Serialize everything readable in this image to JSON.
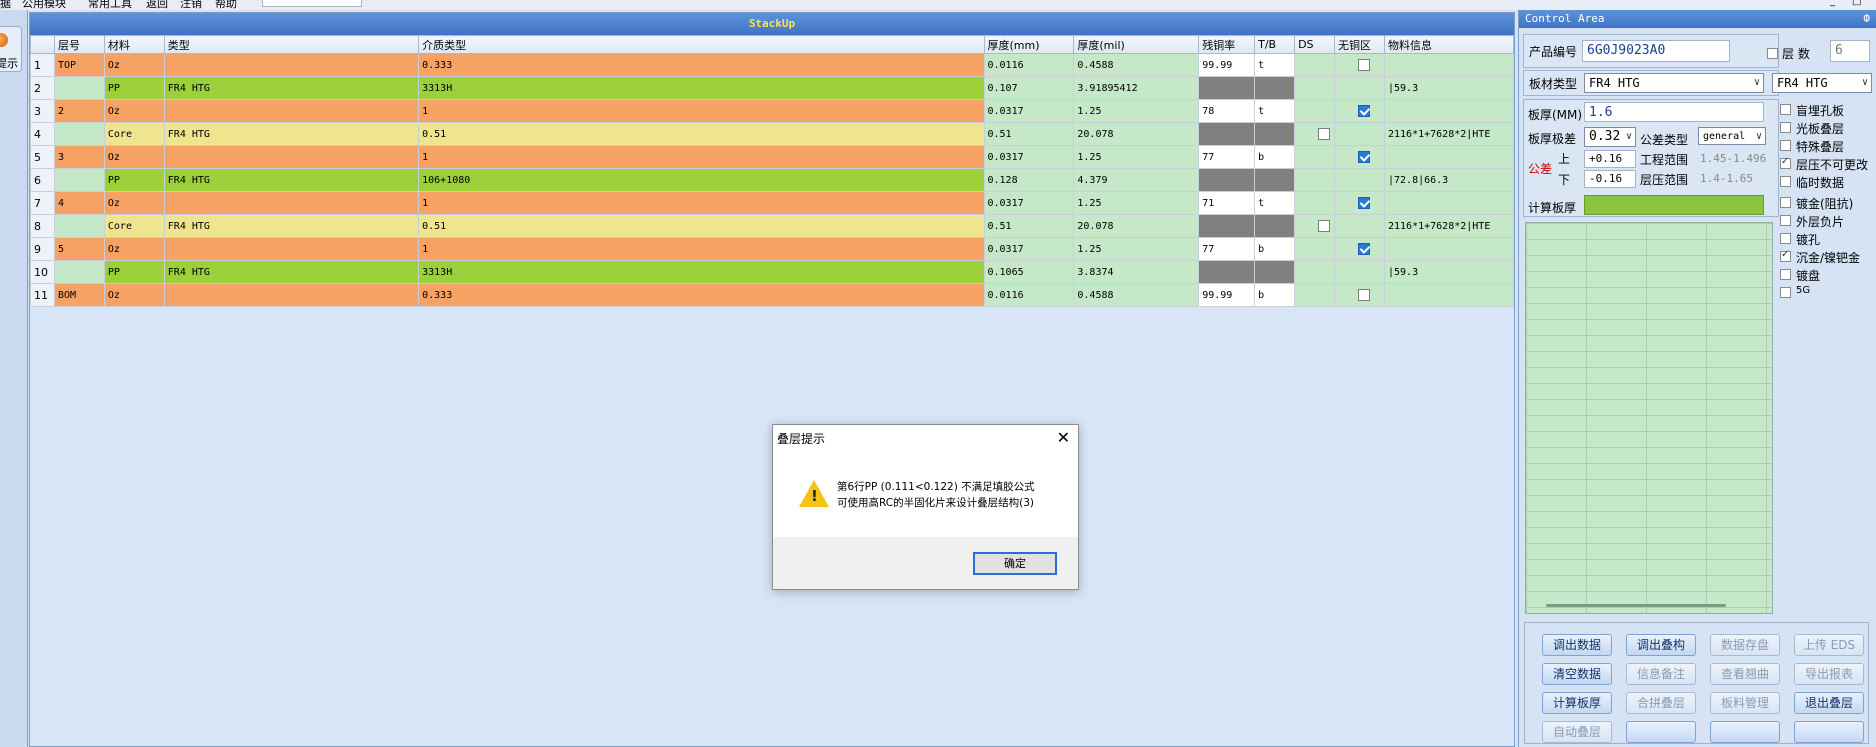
{
  "menubar": {
    "items": [
      "据",
      "公用模块",
      "常用工具",
      "返回",
      "注销",
      "帮助"
    ],
    "controls": [
      "_",
      "□"
    ]
  },
  "left": {
    "tip_label": "提示"
  },
  "stackup": {
    "title": "StackUp",
    "headers": [
      "",
      "层号",
      "材料",
      "类型",
      "介质类型",
      "厚度(mm)",
      "厚度(mil)",
      "残铜率",
      "T/B",
      "DS",
      "无铜区",
      "物料信息"
    ],
    "rows": [
      {
        "n": "1",
        "layer": "TOP",
        "material": "Oz",
        "type": "",
        "dielectric": "0.333",
        "mm": "0.0116",
        "mil": "0.4588",
        "rc": "99.99",
        "tb": "t",
        "ds": "",
        "nocu": "off",
        "info": "",
        "kind": "oz"
      },
      {
        "n": "2",
        "layer": "",
        "material": "PP",
        "type": "FR4 HTG",
        "dielectric": "3313H",
        "mm": "0.107",
        "mil": "3.91895412",
        "rc": "",
        "tb": "",
        "ds": "",
        "nocu": "",
        "info": "|59.3",
        "kind": "pp"
      },
      {
        "n": "3",
        "layer": "2",
        "material": "Oz",
        "type": "",
        "dielectric": "1",
        "mm": "0.0317",
        "mil": "1.25",
        "rc": "78",
        "tb": "t",
        "ds": "",
        "nocu": "on",
        "info": "",
        "kind": "oz"
      },
      {
        "n": "4",
        "layer": "",
        "material": "Core",
        "type": "FR4 HTG",
        "dielectric": "0.51",
        "mm": "0.51",
        "mil": "20.078",
        "rc": "",
        "tb": "",
        "ds": "off",
        "nocu": "",
        "info": "2116*1+7628*2|HTE",
        "kind": "core"
      },
      {
        "n": "5",
        "layer": "3",
        "material": "Oz",
        "type": "",
        "dielectric": "1",
        "mm": "0.0317",
        "mil": "1.25",
        "rc": "77",
        "tb": "b",
        "ds": "",
        "nocu": "on",
        "info": "",
        "kind": "oz"
      },
      {
        "n": "6",
        "layer": "",
        "material": "PP",
        "type": "FR4 HTG",
        "dielectric": "106+1080",
        "mm": "0.128",
        "mil": "4.379",
        "rc": "",
        "tb": "",
        "ds": "",
        "nocu": "",
        "info": "|72.8|66.3",
        "kind": "pp"
      },
      {
        "n": "7",
        "layer": "4",
        "material": "Oz",
        "type": "",
        "dielectric": "1",
        "mm": "0.0317",
        "mil": "1.25",
        "rc": "71",
        "tb": "t",
        "ds": "",
        "nocu": "on",
        "info": "",
        "kind": "oz"
      },
      {
        "n": "8",
        "layer": "",
        "material": "Core",
        "type": "FR4 HTG",
        "dielectric": "0.51",
        "mm": "0.51",
        "mil": "20.078",
        "rc": "",
        "tb": "",
        "ds": "off",
        "nocu": "",
        "info": "2116*1+7628*2|HTE",
        "kind": "core"
      },
      {
        "n": "9",
        "layer": "5",
        "material": "Oz",
        "type": "",
        "dielectric": "1",
        "mm": "0.0317",
        "mil": "1.25",
        "rc": "77",
        "tb": "b",
        "ds": "",
        "nocu": "on",
        "info": "",
        "kind": "oz"
      },
      {
        "n": "10",
        "layer": "",
        "material": "PP",
        "type": "FR4 HTG",
        "dielectric": "3313H",
        "mm": "0.1065",
        "mil": "3.8374",
        "rc": "",
        "tb": "",
        "ds": "",
        "nocu": "",
        "info": "|59.3",
        "kind": "pp"
      },
      {
        "n": "11",
        "layer": "BOM",
        "material": "Oz",
        "type": "",
        "dielectric": "0.333",
        "mm": "0.0116",
        "mil": "0.4588",
        "rc": "99.99",
        "tb": "b",
        "ds": "",
        "nocu": "off",
        "info": "",
        "kind": "oz"
      }
    ]
  },
  "control": {
    "title": "Control Area",
    "pin": "Ф",
    "product_label": "产品编号",
    "product_value": "6G0J9023A0",
    "layers_label": "层  数",
    "layers_value": "6",
    "board_type_label": "板材类型",
    "board_type_value": "FR4 HTG",
    "board_type_value2": "FR4 HTG",
    "thickness_label": "板厚(MM)",
    "thickness_value": "1.6",
    "tol_label": "板厚极差",
    "tol_value": "0.32",
    "tol_type_label": "公差类型",
    "tol_type_value": "general",
    "gongcha_label": "公差",
    "upper_label": "上",
    "upper_value": "+0.16",
    "lower_label": "下",
    "lower_value": "-0.16",
    "eng_range_label": "工程范围",
    "eng_range_value": "1.45-1.496",
    "press_range_label": "层压范围",
    "press_range_value": "1.4-1.65",
    "calc_label": "计算板厚",
    "options": [
      {
        "label": "盲埋孔板",
        "checked": false
      },
      {
        "label": "光板叠层",
        "checked": false
      },
      {
        "label": "特殊叠层",
        "checked": false
      },
      {
        "label": "层压不可更改",
        "checked": true
      },
      {
        "label": "临时数据",
        "checked": false
      },
      {
        "label": "镀金(阻抗)",
        "checked": false
      },
      {
        "label": "外层负片",
        "checked": false
      },
      {
        "label": "镀孔",
        "checked": false
      },
      {
        "label": "沉金/镍钯金",
        "checked": true
      },
      {
        "label": "镀盘",
        "checked": false
      },
      {
        "label": "5G",
        "checked": false
      }
    ],
    "buttons": [
      {
        "label": "调出数据",
        "enabled": true
      },
      {
        "label": "调出叠构",
        "enabled": true
      },
      {
        "label": "数据存盘",
        "enabled": false
      },
      {
        "label": "上传 EDS",
        "enabled": false
      },
      {
        "label": "清空数据",
        "enabled": true
      },
      {
        "label": "信息备注",
        "enabled": false
      },
      {
        "label": "查看翘曲",
        "enabled": false
      },
      {
        "label": "导出报表",
        "enabled": false
      },
      {
        "label": "计算板厚",
        "enabled": true
      },
      {
        "label": "合拼叠层",
        "enabled": false
      },
      {
        "label": "板料管理",
        "enabled": false
      },
      {
        "label": "退出叠层",
        "enabled": true
      },
      {
        "label": "自动叠层",
        "enabled": false
      },
      {
        "label": "",
        "enabled": true
      },
      {
        "label": "",
        "enabled": true
      },
      {
        "label": "",
        "enabled": true
      }
    ]
  },
  "modal": {
    "title": "叠层提示",
    "line1": "第6行PP (0.111<0.122) 不满足填胶公式",
    "line2": "可使用高RC的半固化片来设计叠层结构(3)",
    "ok": "确定"
  }
}
